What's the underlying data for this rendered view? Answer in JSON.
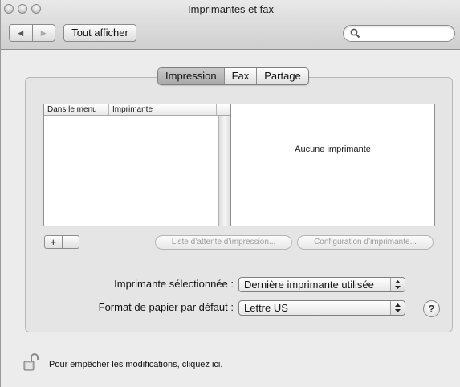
{
  "window": {
    "title": "Imprimantes et fax"
  },
  "toolbar": {
    "back_label": "◀",
    "forward_label": "▶",
    "show_all_label": "Tout afficher",
    "search_placeholder": ""
  },
  "tabs": [
    {
      "label": "Impression",
      "active": true
    },
    {
      "label": "Fax",
      "active": false
    },
    {
      "label": "Partage",
      "active": false
    }
  ],
  "printer_list": {
    "columns": [
      "Dans le menu",
      "Imprimante"
    ],
    "rows": []
  },
  "detail": {
    "empty_text": "Aucune imprimante"
  },
  "list_buttons": {
    "add_label": "+",
    "remove_label": "−"
  },
  "actions": {
    "print_queue_label": "Liste d’attente d’impression...",
    "printer_setup_label": "Configuration d’imprimante..."
  },
  "settings": {
    "selected_printer_label": "Imprimante sélectionnée :",
    "selected_printer_value": "Dernière imprimante utilisée",
    "default_paper_label": "Format de papier par défaut :",
    "default_paper_value": "Lettre US"
  },
  "help": {
    "label": "?"
  },
  "lock": {
    "text": "Pour empêcher les modifications, cliquez ici."
  },
  "icons": {
    "search": "magnifier-icon",
    "lock": "open-padlock-icon",
    "popup_arrows": "up-down-arrows-icon"
  }
}
